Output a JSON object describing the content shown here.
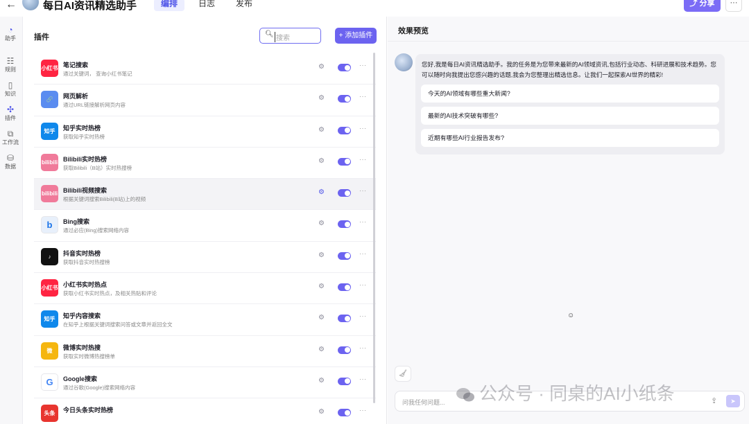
{
  "header": {
    "back": "←",
    "app_title": "每日AI资讯精选助手",
    "tabs": [
      "编排",
      "日志",
      "发布"
    ],
    "active_tab": "编排",
    "share_label": "分享",
    "share_icon": "share-icon",
    "more_label": "···"
  },
  "rail": {
    "items": [
      {
        "label": "助手",
        "icon": "assistant-icon"
      },
      {
        "label": "规则",
        "icon": "rules-icon"
      },
      {
        "label": "知识",
        "icon": "knowledge-icon"
      },
      {
        "label": "插件",
        "icon": "plugin-icon"
      },
      {
        "label": "工作流",
        "icon": "workflow-icon"
      },
      {
        "label": "数据",
        "icon": "database-icon"
      }
    ]
  },
  "plugins": {
    "title": "插件",
    "search_placeholder": "搜索",
    "add_label": "+ 添加插件",
    "items": [
      {
        "name": "笔记搜索",
        "desc": "通过关键词， 查询小红书笔记",
        "logo": "小红书",
        "color": "#ff2442"
      },
      {
        "name": "网页解析",
        "desc": "通过URL链接解析网页内容",
        "logo": "🔗",
        "color": "#5a8cf0"
      },
      {
        "name": "知乎实时热榜",
        "desc": "获取知乎实时热榜",
        "logo": "知乎",
        "color": "#0f88eb"
      },
      {
        "name": "Bilibili实时热榜",
        "desc": "获取Bilibili（B站）实时热搜榜",
        "logo": "bilibili",
        "color": "#f07a9a"
      },
      {
        "name": "Bilibili视频搜索",
        "desc": "根据关键词搜索Bilibili(B站)上的视频",
        "logo": "bilibili",
        "color": "#f07a9a"
      },
      {
        "name": "Bing搜索",
        "desc": "通过必应(Bing)搜索网络内容",
        "logo": "b",
        "color": "#e8f0fb"
      },
      {
        "name": "抖音实时热榜",
        "desc": "获取抖音实时热搜榜",
        "logo": "♪",
        "color": "#111111"
      },
      {
        "name": "小红书实时热点",
        "desc": "获取小红书实时热点，及相关热贴和评论",
        "logo": "小红书",
        "color": "#ff2442"
      },
      {
        "name": "知乎内容搜索",
        "desc": "在知乎上根据关键词搜索问答或文章并返回全文",
        "logo": "知乎",
        "color": "#0f88eb"
      },
      {
        "name": "微博实时热搜",
        "desc": "获取实时微博热搜榜单",
        "logo": "微",
        "color": "#f5b60f"
      },
      {
        "name": "Google搜索",
        "desc": "通过谷歌(Google)搜索网络内容",
        "logo": "G",
        "color": "#ffffff"
      },
      {
        "name": "今日头条实时热榜",
        "desc": "",
        "logo": "头条",
        "color": "#e8352f"
      }
    ]
  },
  "preview": {
    "title": "效果预览",
    "greeting": "您好,我是每日AI资讯精选助手。我的任务是为您带来最新的AI领域资讯,包括行业动态、科研进展和技术趋势。您可以随时向我提出您感兴趣的话题,我会为您整理出精选信息。让我们一起探索AI世界的精彩!",
    "suggestions": [
      "今天的AI领域有哪些重大新闻?",
      "最新的AI技术突破有哪些?",
      "近期有哪些AI行业报告发布?"
    ],
    "input_placeholder": "问我任何问题...",
    "watermark": "公众号 · 同桌的AI小纸条"
  }
}
